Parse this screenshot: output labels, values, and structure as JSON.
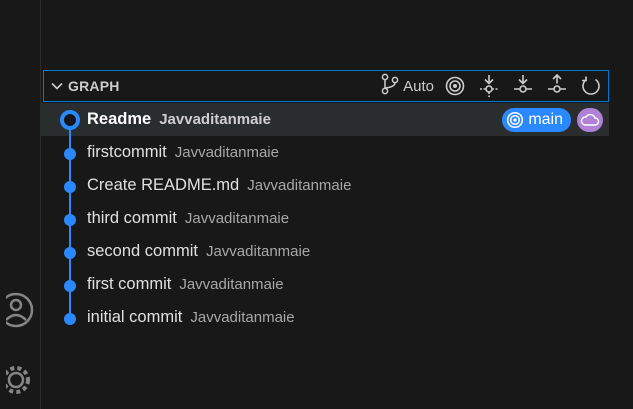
{
  "graph": {
    "title": "GRAPH",
    "auto_label": "Auto"
  },
  "commits": [
    {
      "message": "Readme",
      "author": "Javvaditanmaie"
    },
    {
      "message": "firstcommit",
      "author": "Javvaditanmaie"
    },
    {
      "message": "Create README.md",
      "author": "Javvaditanmaie"
    },
    {
      "message": "third commit",
      "author": "Javvaditanmaie"
    },
    {
      "message": "second commit",
      "author": "Javvaditanmaie"
    },
    {
      "message": "first commit",
      "author": "Javvaditanmaie"
    },
    {
      "message": "initial commit",
      "author": "Javvaditanmaie"
    }
  ],
  "badges": {
    "branch": "main"
  },
  "colors": {
    "accent": "#2b89ff",
    "remote_badge": "#b180d7",
    "focus_border": "#0078d4"
  },
  "icons": {
    "activity": [
      "accounts-icon",
      "manage-gear-icon"
    ],
    "header": [
      "chevron-down-icon",
      "source-control-icon",
      "target-icon",
      "fetch-icon",
      "pull-icon",
      "push-icon",
      "refresh-icon"
    ]
  }
}
